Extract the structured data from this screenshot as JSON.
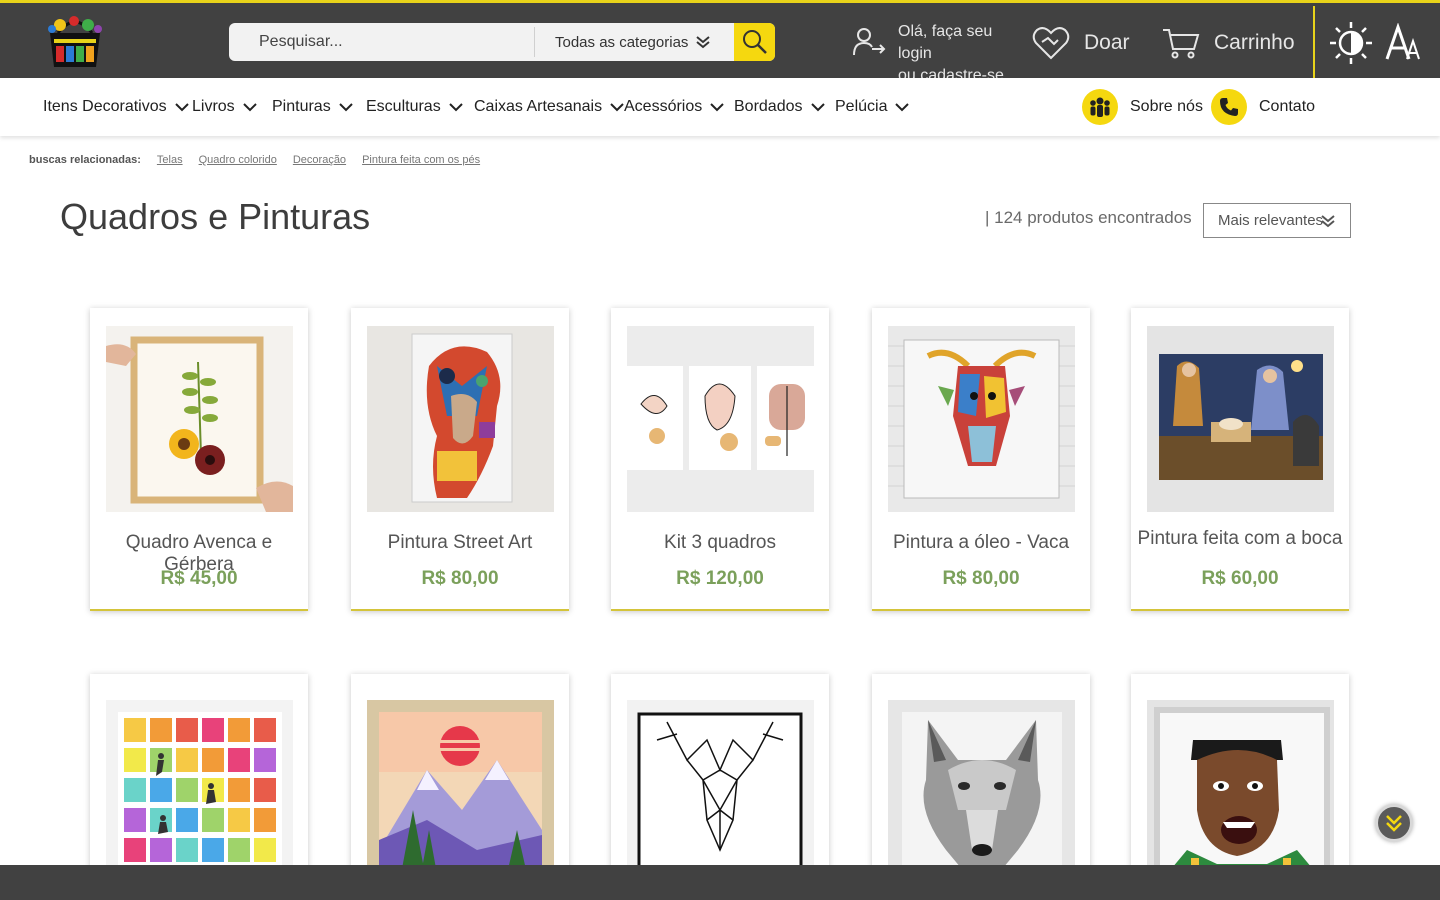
{
  "header": {
    "search_placeholder": "Pesquisar...",
    "category_select": "Todas as categorias",
    "login_line1": "Olá, faça seu login",
    "login_line2": "ou cadastre-se",
    "donate": "Doar",
    "cart": "Carrinho",
    "font_toggle": "A"
  },
  "nav": {
    "items": [
      {
        "label": "Itens Decorativos"
      },
      {
        "label": "Livros"
      },
      {
        "label": "Pinturas"
      },
      {
        "label": "Esculturas"
      },
      {
        "label": "Caixas Artesanais"
      },
      {
        "label": "Acessórios"
      },
      {
        "label": "Bordados"
      },
      {
        "label": "Pelúcia"
      }
    ],
    "about": "Sobre nós",
    "contact": "Contato"
  },
  "related": {
    "label": "buscas relacionadas:",
    "links": [
      "Telas",
      "Quadro colorido",
      "Decoração",
      "Pintura feita com os pés"
    ]
  },
  "listing": {
    "title": "Quadros e Pinturas",
    "count": "| 124 produtos encontrados",
    "sort": "Mais relevantes"
  },
  "products": [
    {
      "name": "Quadro Avenca e Gérbera",
      "price": "R$ 45,00"
    },
    {
      "name": "Pintura Street Art",
      "price": "R$ 80,00"
    },
    {
      "name": "Kit 3 quadros",
      "price": "R$ 120,00"
    },
    {
      "name": "Pintura a óleo - Vaca",
      "price": "R$ 80,00"
    },
    {
      "name": "Pintura feita com a boca",
      "price": "R$ 60,00"
    }
  ],
  "colors": {
    "header_bg": "#414141",
    "accent_yellow": "#f5d80f",
    "price_green": "#7ba05b"
  }
}
